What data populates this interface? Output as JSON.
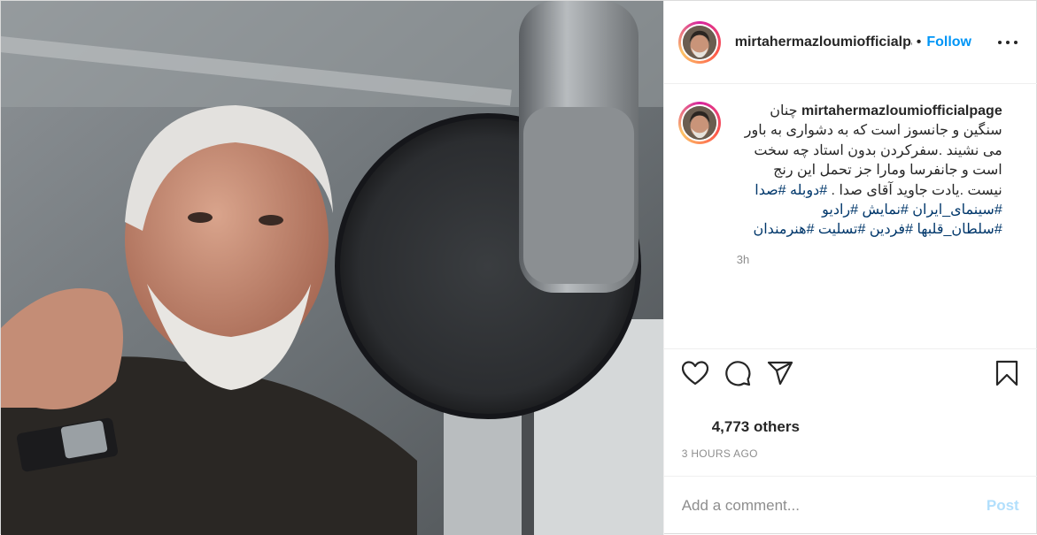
{
  "header": {
    "username": "mirtahermazloumiofficialpage",
    "separator": "•",
    "follow_label": "Follow"
  },
  "caption": {
    "username": "mirtahermazloumiofficialpage",
    "text": "چنان سنگین و جانسوز است که به دشواری به باور می نشیند .سفرکردن بدون استاد چه سخت است و جانفرسا ومارا جز تحمل این رنج نیست .یادت جاوید آقای صدا . ",
    "hashtags": [
      "#دوبله",
      "#صدا",
      "#سینمای_ایران",
      "#نمایش",
      "#رادیو",
      "#سلطان_قلبها",
      "#فردین",
      "#تسلیت",
      "#هنرمندان"
    ],
    "age": "3h"
  },
  "actions": {
    "like_icon": "heart-icon",
    "comment_icon": "comment-icon",
    "share_icon": "paper-plane-icon",
    "save_icon": "bookmark-icon"
  },
  "likes": {
    "text": "4,773 others"
  },
  "posted_time": "3 HOURS AGO",
  "comment": {
    "placeholder": "Add a comment...",
    "post_label": "Post"
  },
  "colors": {
    "link_blue": "#0095f6",
    "hashtag": "#00376b",
    "muted": "#8e8e8e",
    "post_disabled": "#b2dffc"
  }
}
